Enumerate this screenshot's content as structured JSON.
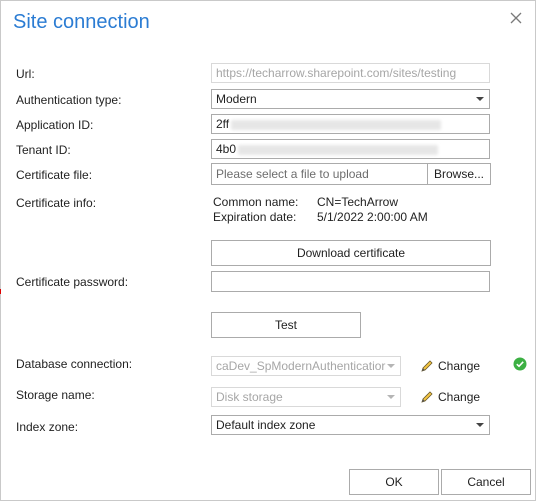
{
  "dialog": {
    "title": "Site connection",
    "close_icon": "close-icon"
  },
  "form": {
    "url": {
      "label": "Url:",
      "value": "https://techarrow.sharepoint.com/sites/testing"
    },
    "auth_type": {
      "label": "Authentication type:",
      "value": "Modern"
    },
    "app_id": {
      "label": "Application ID:",
      "value": "2ff"
    },
    "tenant_id": {
      "label": "Tenant ID:",
      "value": "4b0"
    },
    "cert_file": {
      "label": "Certificate file:",
      "placeholder": "Please select a file to upload",
      "browse_label": "Browse..."
    },
    "cert_info": {
      "label": "Certificate info:",
      "common_name_key": "Common name:",
      "common_name_val": "CN=TechArrow",
      "expiration_key": "Expiration date:",
      "expiration_val": "5/1/2022 2:00:00 AM"
    },
    "download_label": "Download certificate",
    "cert_password": {
      "label": "Certificate password:",
      "value": ""
    },
    "test_label": "Test",
    "db_connection": {
      "label": "Database connection:",
      "value": "caDev_SpModernAuthenticatior",
      "change_label": "Change",
      "status_icon": "check-circle-icon",
      "status_color": "#3cb043"
    },
    "storage_name": {
      "label": "Storage name:",
      "value": "Disk storage",
      "change_label": "Change"
    },
    "index_zone": {
      "label": "Index zone:",
      "value": "Default index zone"
    }
  },
  "footer": {
    "ok_label": "OK",
    "cancel_label": "Cancel"
  },
  "colors": {
    "title": "#2b7cd3",
    "border": "#ababab"
  }
}
